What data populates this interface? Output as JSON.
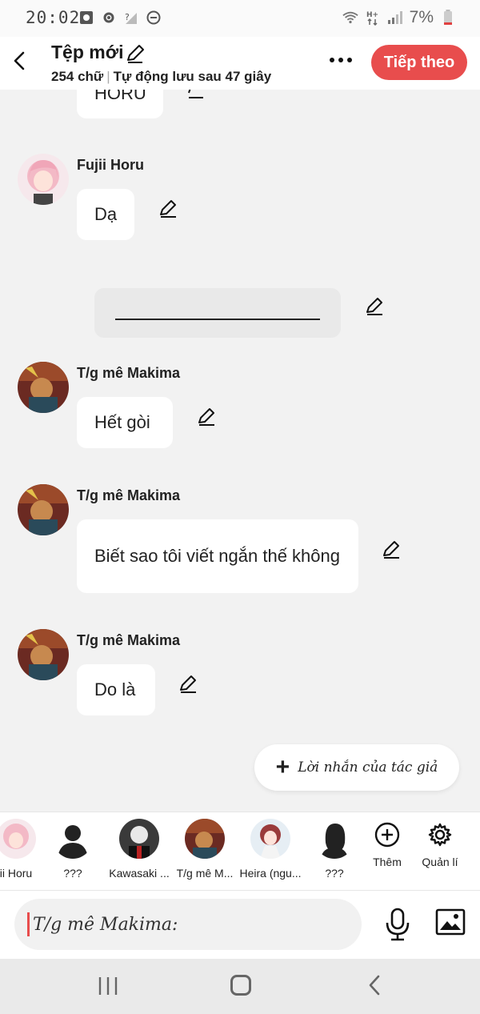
{
  "status_bar": {
    "time": "20:02",
    "battery": "7%"
  },
  "header": {
    "title": "Tệp mới",
    "word_count": "254 chữ",
    "autosave": "Tự động lưu sau 47 giây",
    "next_button": "Tiếp theo"
  },
  "chat": {
    "partial_message": "HORU",
    "messages": [
      {
        "name": "Fujii Horu",
        "text": "Dạ"
      },
      {
        "name": "",
        "text": ""
      },
      {
        "name": "T/g mê Makima",
        "text": "Hết gòi"
      },
      {
        "name": "T/g mê Makima",
        "text": "Biết sao tôi viết ngắn thế không"
      },
      {
        "name": "T/g mê Makima",
        "text": "Do là"
      }
    ],
    "author_note_button": "Lời nhắn của tác giả"
  },
  "characters": [
    {
      "label": "ii Horu"
    },
    {
      "label": "???"
    },
    {
      "label": "Kawasaki ..."
    },
    {
      "label": "T/g mê M..."
    },
    {
      "label": "Heira (ngu..."
    },
    {
      "label": "???"
    }
  ],
  "tools": {
    "add_label": "Thêm",
    "manage_label": "Quản lí"
  },
  "input": {
    "placeholder": "T/g mê Makima:"
  },
  "colors": {
    "accent": "#e84d4d",
    "background": "#f2f2f2"
  }
}
